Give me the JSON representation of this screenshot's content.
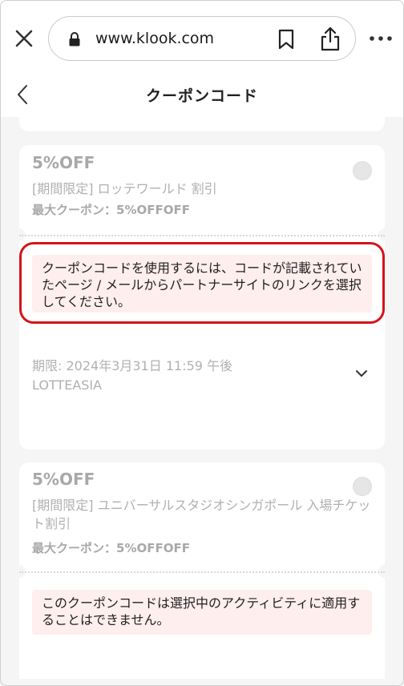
{
  "browser": {
    "url": "www.klook.com",
    "icons": [
      "close-icon",
      "lock-icon",
      "bookmark-icon",
      "share-icon",
      "more-icon"
    ]
  },
  "header": {
    "title": "クーポンコード",
    "back_icon": "chevron-left-icon"
  },
  "coupons": [
    {
      "discount": "5%OFF",
      "name": "[期間限定] ロッテワールド 割引",
      "max_label": "最大クーポン：5%OFFOFF",
      "notice": "クーポンコードを使用するには、コードが記載されていたページ / メールからパートナーサイトのリンクを選択してください。",
      "expiry": "期限: 2024年3月31日 11:59 午後",
      "code": "LOTTEASIA",
      "highlighted": true
    },
    {
      "discount": "5%OFF",
      "name": "[期間限定] ユニバーサルスタジオシンガポール 入場チケット割引",
      "max_label": "最大クーポン：5%OFFOFF",
      "notice": "このクーポンコードは選択中のアクティビティに適用することはできません。"
    }
  ],
  "colors": {
    "highlight_ring": "#d4131b",
    "notice_bg": "#ffeeee",
    "disabled_text": "#a8a8a8"
  }
}
